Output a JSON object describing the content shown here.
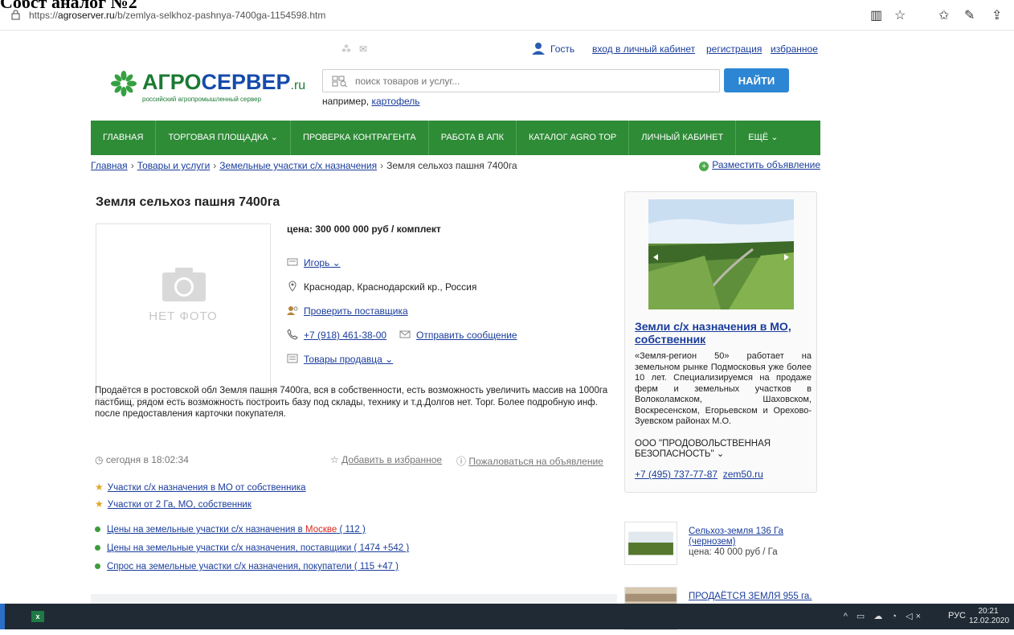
{
  "overlay_caption": "Собст аналог №2",
  "browser": {
    "url_prefix": "https://",
    "url_host": "agroserver.ru",
    "url_path": "/b/zemlya-selkhoz-pashnya-7400ga-1154598.htm"
  },
  "header": {
    "guest": "Гость",
    "login": "вход в личный кабинет",
    "register": "регистрация",
    "favorites": "избранное",
    "logo_main_a": "АГРО",
    "logo_main_b": "СЕРВЕР",
    "logo_ru": ".ru",
    "logo_sub": "российский агропромышленный сервер",
    "search_placeholder": "поиск товаров и услуг...",
    "search_button": "НАЙТИ",
    "example_prefix": "например,",
    "example_link": "картофель"
  },
  "nav": [
    "ГЛАВНАЯ",
    "ТОРГОВАЯ ПЛОЩАДКА ⌄",
    "ПРОВЕРКА КОНТРАГЕНТА",
    "РАБОТА В АПК",
    "КАТАЛОГ AGRO TOP",
    "ЛИЧНЫЙ КАБИНЕТ",
    "ЕЩЁ ⌄"
  ],
  "breadcrumbs": {
    "items": [
      "Главная",
      "Товары и услуги",
      "Земельные участки с/х назначения"
    ],
    "current": "Земля сельхоз пашня 7400га",
    "post_ad": "Разместить объявление"
  },
  "listing": {
    "title": "Земля сельхоз пашня 7400га",
    "no_photo": "НЕТ ФОТО",
    "price": "цена: 300 000 000 руб / комплект",
    "seller": "Игорь ⌄",
    "location": "Краснодар, Краснодарский кр., Россия",
    "check_supplier": "Проверить поставщика",
    "phone": "+7 (918) 461-38-00",
    "send_message": "Отправить сообщение",
    "seller_goods": "Товары продавца ⌄",
    "description": "Продаётся в ростовской обл Земля пашня 7400га, вся в собственности, есть возможность увеличить массив на 1000га пастбищ, рядом есть возможность построить базу под склады, технику и т.д.Долгов нет. Торг. Более подробную инф. после предоставления карточки покупателя.",
    "date": "сегодня в 18:02:34",
    "add_favorite": "Добавить в избранное",
    "complain": "Пожаловаться на объявление"
  },
  "related": {
    "starred": [
      "Участки с/х назначения в МО от собственника",
      "Участки от 2 Га, МО, собственник"
    ],
    "prices_prefix": "Цены на земельные участки с/х назначения в ",
    "prices_city": "Москве",
    "prices_suffix": " ( 112 )",
    "suppliers": "Цены на земельные участки с/х назначения, поставщики ( 1474 +542 )",
    "demand": "Спрос на земельные участки с/х назначения, покупатели ( 115 +47 )"
  },
  "ad_card": {
    "title": "Земли с/х назначения в МО, собственник",
    "text": "«Земля-регион 50» работает на земельном рынке Подмосковья уже более 10 лет. Специализируемся на продаже ферм и земельных участков в Волоколамском, Шаховском, Воскресенском, Егорьевском и Орехово-Зуевском районах М.О.",
    "org": "ООО \"ПРОДОВОЛЬСТВЕННАЯ БЕЗОПАСНОСТЬ\" ⌄",
    "phone": "+7 (495) 737-77-87",
    "site": "zem50.ru"
  },
  "side_listings": [
    {
      "title": "Сельхоз-земля 136 Га (чернозем)",
      "price": "цена: 40 000 руб / Га"
    },
    {
      "title": "ПРОДАЁТСЯ ЗЕМЛЯ 955 га.",
      "price": ""
    }
  ],
  "taskbar": {
    "lang": "РУС",
    "time": "20:21",
    "date": "12.02.2020"
  }
}
